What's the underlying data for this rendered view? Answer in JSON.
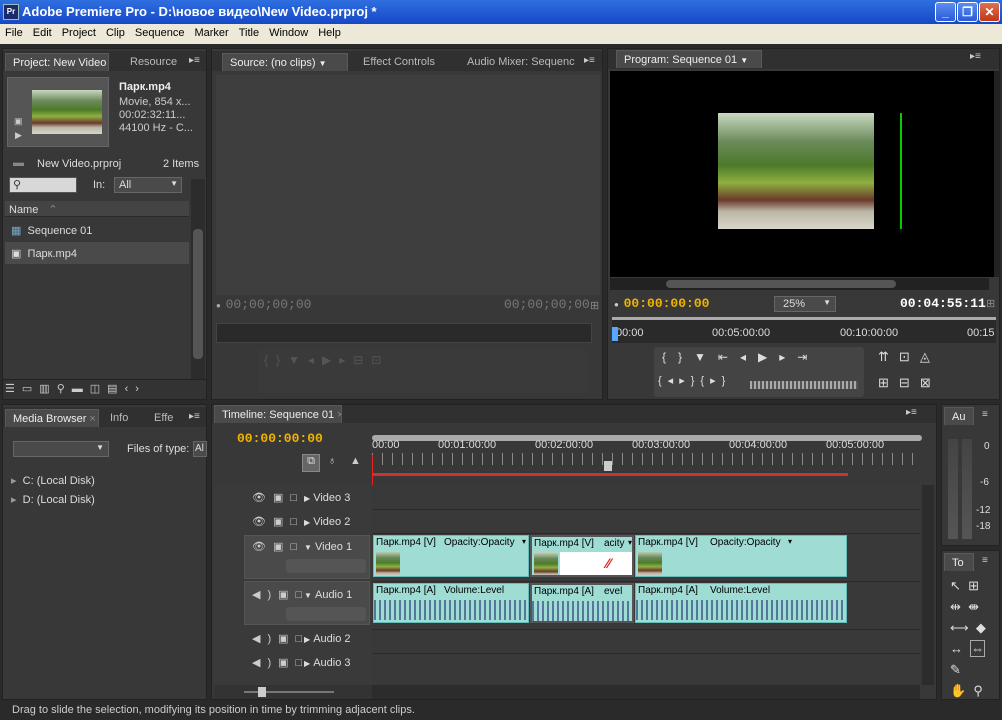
{
  "window": {
    "title": "Adobe Premiere Pro - D:\\новое видео\\New Video.prproj *",
    "app_icon": "Pr"
  },
  "menu": [
    "File",
    "Edit",
    "Project",
    "Clip",
    "Sequence",
    "Marker",
    "Title",
    "Window",
    "Help"
  ],
  "project": {
    "tabs": [
      "Project: New Video",
      "Resource"
    ],
    "preview": {
      "name": "Парк.mp4",
      "line1": "Movie, 854 x...",
      "line2": "00:02:32:11...",
      "line3": "44100 Hz - C..."
    },
    "file_name": "New Video.prproj",
    "item_count": "2 Items",
    "in_label": "In:",
    "in_value": "All",
    "column_name": "Name",
    "items": [
      {
        "label": "Sequence 01"
      },
      {
        "label": "Парк.mp4"
      }
    ]
  },
  "source": {
    "tabs": [
      "Source: (no clips)",
      "Effect Controls",
      "Audio Mixer: Sequenc"
    ],
    "timecode_left": "00;00;00;00",
    "timecode_right": "00;00;00;00"
  },
  "program": {
    "tab": "Program: Sequence 01",
    "timecode": "00:00:00:00",
    "zoom": "25%",
    "duration": "00:04:55:11",
    "ruler": [
      "00:00",
      "00:05:00:00",
      "00:10:00:00",
      "00:15"
    ]
  },
  "media_browser": {
    "tabs": [
      "Media Browser",
      "Info",
      "Effe"
    ],
    "files_of_type": "Files of type:",
    "files_value": "Al",
    "drives": [
      "C: (Local Disk)",
      "D: (Local Disk)"
    ]
  },
  "timeline": {
    "tab": "Timeline: Sequence 01",
    "timecode": "00:00:00:00",
    "ruler": [
      "00:00",
      "00:01:00:00",
      "00:02:00:00",
      "00:03:00:00",
      "00:04:00:00",
      "00:05:00:00"
    ],
    "tracks": [
      "Video 3",
      "Video 2",
      "Video 1",
      "Audio 1",
      "Audio 2",
      "Audio 3"
    ],
    "video_clips": [
      {
        "name": "Парк.mp4 [V]",
        "fx": "Opacity:Opacity"
      },
      {
        "name": "Парк.mp4 [V]",
        "fx": "acity"
      },
      {
        "name": "Парк.mp4 [V]",
        "fx": "Opacity:Opacity"
      }
    ],
    "audio_clips": [
      {
        "name": "Парк.mp4 [A]",
        "fx": "Volume:Level"
      },
      {
        "name": "Парк.mp4 [A]",
        "fx": "evel"
      },
      {
        "name": "Парк.mp4 [A]",
        "fx": "Volume:Level"
      }
    ]
  },
  "audio_meter": {
    "tab": "Au",
    "labels": [
      "0",
      "-6",
      "-12",
      "-18"
    ]
  },
  "tools": {
    "tab": "To"
  },
  "status": "Drag to slide the selection, modifying its position in time by trimming adjacent clips."
}
